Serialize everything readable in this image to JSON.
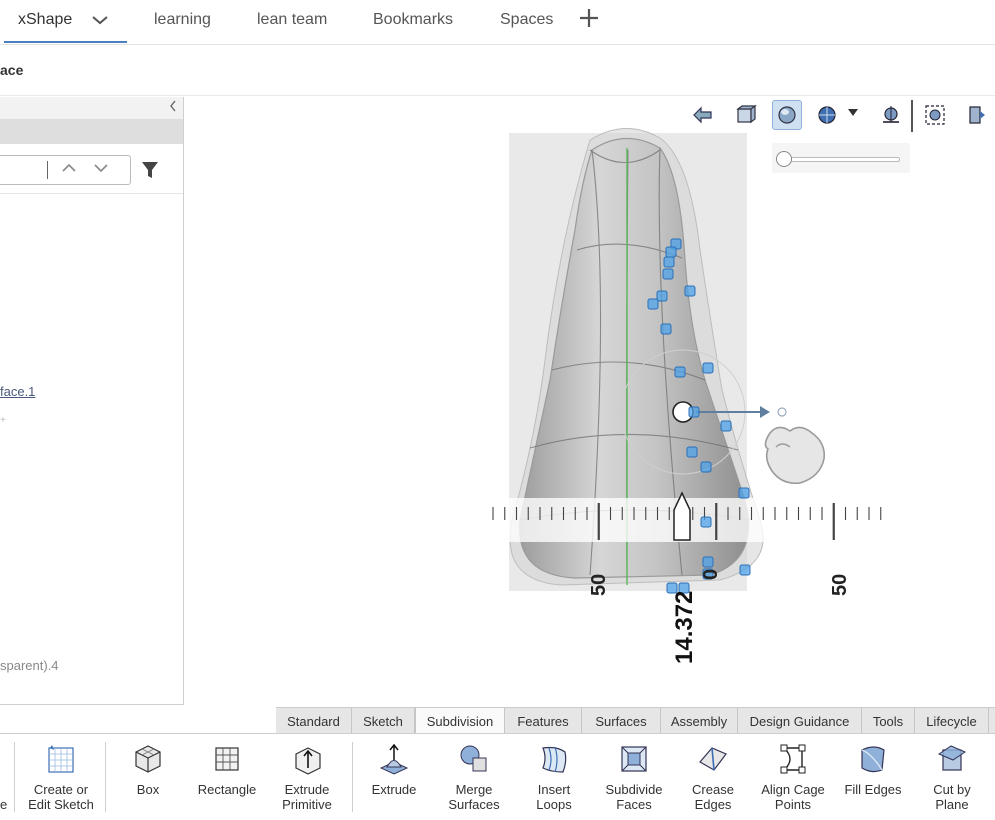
{
  "top_tabs": [
    {
      "label": "xShape"
    },
    {
      "label": "learning"
    },
    {
      "label": "lean team"
    },
    {
      "label": "Bookmarks"
    },
    {
      "label": "Spaces"
    }
  ],
  "breadcrumb": "ace",
  "tree": {
    "item_1": "face.1",
    "item_2": "sparent).4"
  },
  "ruler": {
    "label_left": "50",
    "label_center": "0",
    "label_right": "50",
    "value": "14.372"
  },
  "slider": {
    "value": 0.0
  },
  "toolbar_tabs": [
    "Standard",
    "Sketch",
    "Subdivision",
    "Features",
    "Surfaces",
    "Assembly",
    "Design Guidance",
    "Tools",
    "Lifecycle"
  ],
  "toolbar_active_tab": "Subdivision",
  "tools": {
    "partial_left": "e",
    "create_sketch": [
      "Create or",
      "Edit Sketch"
    ],
    "box": [
      "Box"
    ],
    "rectangle": [
      "Rectangle"
    ],
    "extrude_primitive": [
      "Extrude",
      "Primitive"
    ],
    "extrude": [
      "Extrude"
    ],
    "merge_surfaces": [
      "Merge",
      "Surfaces"
    ],
    "insert_loops": [
      "Insert",
      "Loops"
    ],
    "subdivide_faces": [
      "Subdivide",
      "Faces"
    ],
    "crease_edges": [
      "Crease",
      "Edges"
    ],
    "align_cage_points": [
      "Align Cage",
      "Points"
    ],
    "fill_edges": [
      "Fill Edges"
    ],
    "cut_by_plane": [
      "Cut by",
      "Plane"
    ]
  },
  "colors": {
    "accent": "#4a7fc1",
    "cage_point": "#4da3e8",
    "active_tool": "#cfe0f3"
  }
}
